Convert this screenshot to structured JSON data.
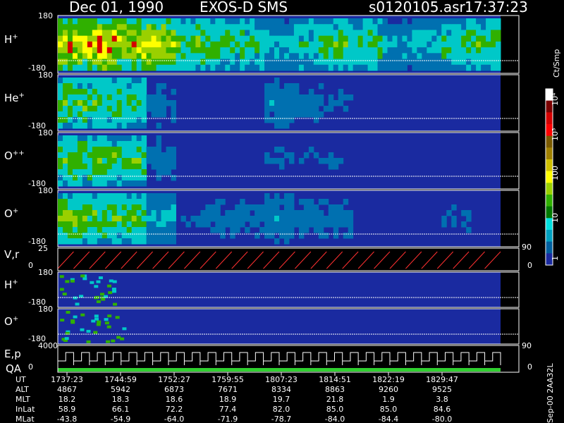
{
  "header": {
    "date": "Dec 01, 1990",
    "instrument": "EXOS-D SMS",
    "file": "s0120105.asr",
    "time": "17:37:23"
  },
  "colorbar": {
    "unit": "Ct/Smp",
    "ticks": [
      "10⁴",
      "10³",
      "100",
      "10",
      "1"
    ],
    "colors": [
      "#ffffff",
      "#7a0000",
      "#d40000",
      "#ff0000",
      "#7a5a00",
      "#a08000",
      "#d0c000",
      "#ffff00",
      "#9ad000",
      "#30b000",
      "#007800",
      "#00e0e0",
      "#00a0c0",
      "#0060a0",
      "#1a2aa0"
    ]
  },
  "chart_data": {
    "type": "heatmap",
    "title": "Dec 01, 1990   EXOS-D SMS",
    "time_axis": {
      "label": "UT",
      "ticks": [
        "1737:23",
        "1744:59",
        "1752:27",
        "1759:55",
        "1807:23",
        "1814:51",
        "1822:19",
        "1829:47"
      ]
    },
    "panels": [
      {
        "label": "H",
        "sup": "+",
        "ymax": "180",
        "ymin": "-180",
        "intensity": [
          [
            0.9,
            0.95,
            0.9,
            0.8,
            0.6,
            0.55,
            0.5,
            0.35,
            0.45,
            0.55,
            0.5,
            0.3,
            0.35,
            0.5,
            0.55
          ]
        ]
      },
      {
        "label": "He",
        "sup": "+",
        "ymax": "180",
        "ymin": "-180",
        "intensity": [
          [
            0.6,
            0.55,
            0.5,
            0.2,
            0.1,
            0.1,
            0.1,
            0.25,
            0.2,
            0.15,
            0.1,
            0.05,
            0.05,
            0.05,
            0.05
          ]
        ]
      },
      {
        "label": "O",
        "sup": "++",
        "ymax": "180",
        "ymin": "-180",
        "intensity": [
          [
            0.6,
            0.6,
            0.55,
            0.2,
            0.1,
            0.1,
            0.1,
            0.15,
            0.15,
            0.15,
            0.1,
            0.05,
            0.05,
            0.05,
            0.05
          ]
        ]
      },
      {
        "label": "O",
        "sup": "+",
        "ymax": "180",
        "ymin": "-180",
        "intensity": [
          [
            0.65,
            0.6,
            0.55,
            0.3,
            0.15,
            0.2,
            0.2,
            0.25,
            0.2,
            0.2,
            0.1,
            0.05,
            0.1,
            0.15,
            0.05
          ]
        ]
      },
      {
        "label": "V,r",
        "sup": "",
        "ymax": "25",
        "ymin": "0",
        "right_top": "90",
        "right_bottom": "0"
      },
      {
        "label": "H",
        "sup": "+",
        "ymax": "180",
        "ymin": "-180"
      },
      {
        "label": "O",
        "sup": "+",
        "ymax": "180",
        "ymin": "-180"
      },
      {
        "label": "E,p",
        "sup": "",
        "ymax": "4000",
        "ymin": "0",
        "right_top": "90",
        "right_bottom": "0",
        "label2": "QA"
      }
    ],
    "orbit_table": {
      "rows": [
        {
          "name": "UT",
          "values": [
            "1737:23",
            "1744:59",
            "1752:27",
            "1759:55",
            "1807:23",
            "1814:51",
            "1822:19",
            "1829:47"
          ]
        },
        {
          "name": "ALT",
          "values": [
            "4867",
            "5942",
            "6873",
            "7671",
            "8334",
            "8863",
            "9260",
            "9525"
          ]
        },
        {
          "name": "MLT",
          "values": [
            "18.2",
            "18.3",
            "18.6",
            "18.9",
            "19.7",
            "21.8",
            "1.9",
            "3.8"
          ]
        },
        {
          "name": "InLat",
          "values": [
            "58.9",
            "66.1",
            "72.2",
            "77.4",
            "82.0",
            "85.0",
            "85.0",
            "84.6"
          ]
        },
        {
          "name": "MLat",
          "values": [
            "-43.8",
            "-54.9",
            "-64.0",
            "-71.9",
            "-78.7",
            "-84.0",
            "-84.4",
            "-80.0"
          ]
        }
      ]
    }
  },
  "footer_right": "Sep-00  2AA32L"
}
